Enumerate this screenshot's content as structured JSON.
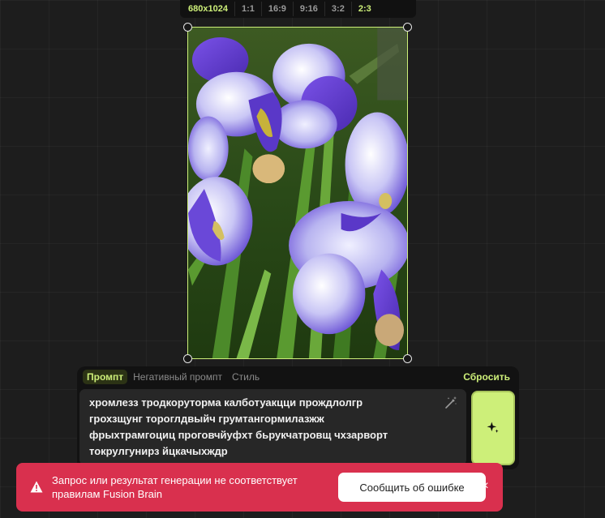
{
  "ratio_bar": {
    "options": [
      "680x1024",
      "1:1",
      "16:9",
      "9:16",
      "3:2",
      "2:3"
    ],
    "selected": "2:3"
  },
  "image": {
    "description_icon": "iris-flowers-image"
  },
  "prompt_panel": {
    "tabs": [
      "Промпт",
      "Негативный промпт",
      "Стиль"
    ],
    "active_tab": "Промпт",
    "reset_label": "Сбросить",
    "prompt_text": "хромлезз тродкоруторма калботуакцци прождлолгр\nгрохзщунг тороглдвыйч грумтангормилазжж\nфрыхтрамгоциц проговчйуфхт бьрукчатровщ чхзарворт\nтокрулгунирз йцкачыхждр"
  },
  "error_toast": {
    "message": "Запрос или результат генерации не соответствует правилам Fusion Brain",
    "report_label": "Сообщить об ошибке",
    "close_label": "×"
  },
  "colors": {
    "accent": "#cdef79",
    "error": "#d9304e",
    "panel": "#121212",
    "canvas": "#1d1d1d"
  }
}
